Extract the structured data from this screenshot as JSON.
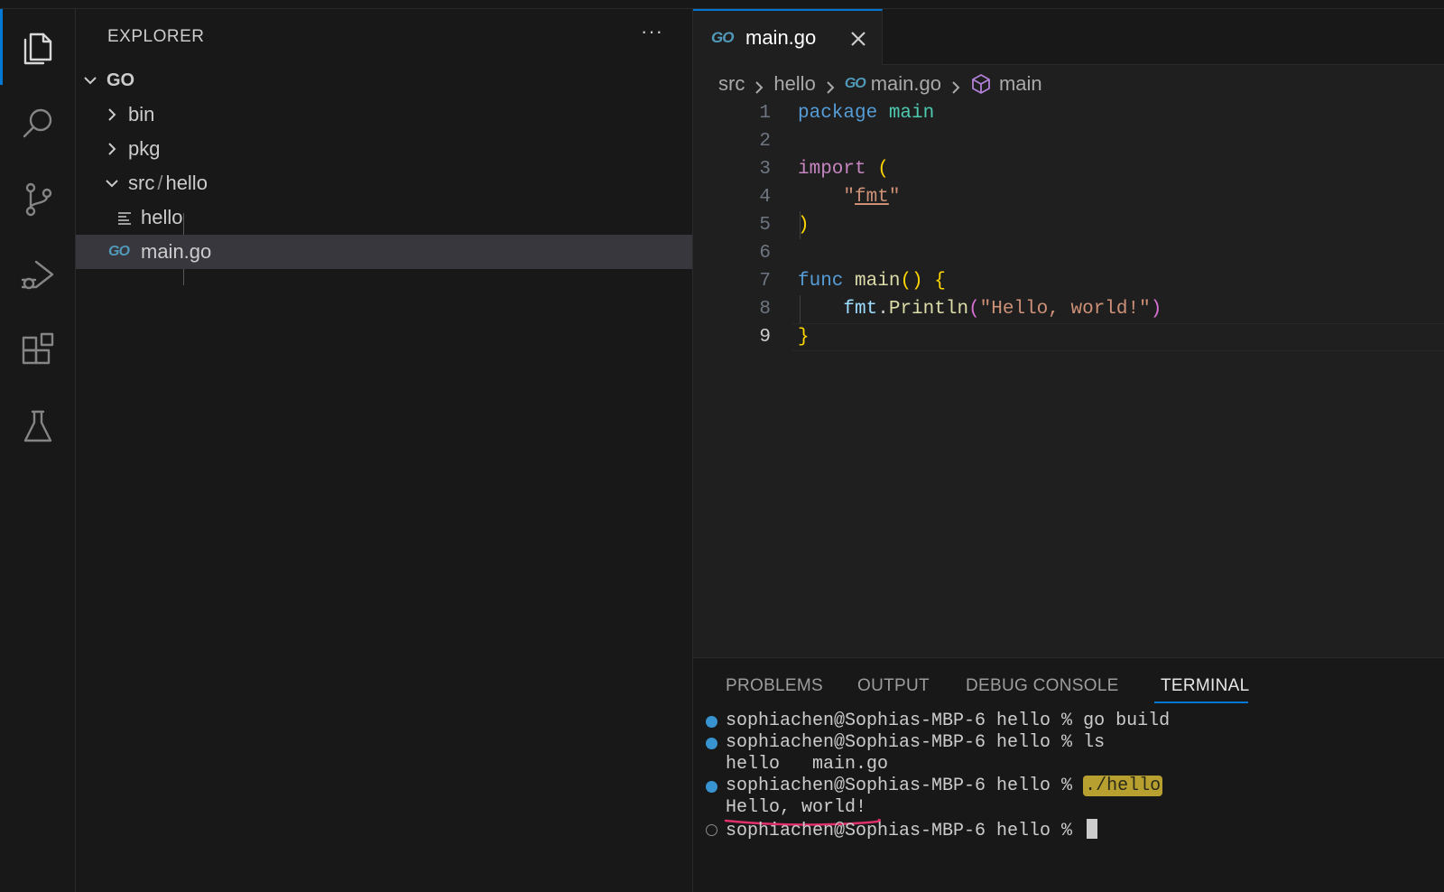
{
  "explorer": {
    "title": "EXPLORER",
    "more": "···",
    "root": "GO",
    "items": [
      {
        "label": "bin",
        "type": "folder",
        "expanded": false
      },
      {
        "label": "pkg",
        "type": "folder",
        "expanded": false
      },
      {
        "label_a": "src",
        "sep": "/",
        "label_b": "hello",
        "type": "folder",
        "expanded": true
      },
      {
        "label": "hello",
        "type": "file",
        "icon": "text-file-icon"
      },
      {
        "label": "main.go",
        "type": "file",
        "icon": "go-file-icon",
        "selected": true
      }
    ]
  },
  "go_glyph": "GO",
  "tab": {
    "label": "main.go"
  },
  "breadcrumb": [
    "src",
    "hello",
    "main.go",
    "main"
  ],
  "code": {
    "line_numbers": [
      "1",
      "2",
      "3",
      "4",
      "5",
      "6",
      "7",
      "8",
      "9"
    ],
    "current_line": 9,
    "l1": {
      "kw": "package",
      "name": "main"
    },
    "l3": {
      "kw": "import",
      "paren": "("
    },
    "l4": {
      "q1": "\"",
      "val": "fmt",
      "q2": "\""
    },
    "l5": {
      "paren": ")"
    },
    "l7": {
      "kw": "func",
      "fn": "main",
      "parens": "()",
      "brace": "{"
    },
    "l8": {
      "pkg": "fmt",
      "dot": ".",
      "fn": "Println",
      "open": "(",
      "str": "\"Hello, world!\"",
      "close": ")"
    },
    "l9": {
      "brace": "}"
    }
  },
  "panel": {
    "tabs": [
      "PROBLEMS",
      "OUTPUT",
      "DEBUG CONSOLE",
      "TERMINAL"
    ],
    "active_tab": "TERMINAL"
  },
  "terminal": {
    "prompt": "sophiachen@Sophias-MBP-6 hello % ",
    "cmd1": "go build",
    "cmd2": "ls",
    "ls_output": "hello   main.go",
    "cmd3": "./hello",
    "run_output": "Hello, world!",
    "cmd4": ""
  },
  "colors": {
    "accent": "#0078d4",
    "terminal_dot": "#3794d1",
    "highlight": "#b8a030",
    "annotation_underline": "#e0306a"
  }
}
